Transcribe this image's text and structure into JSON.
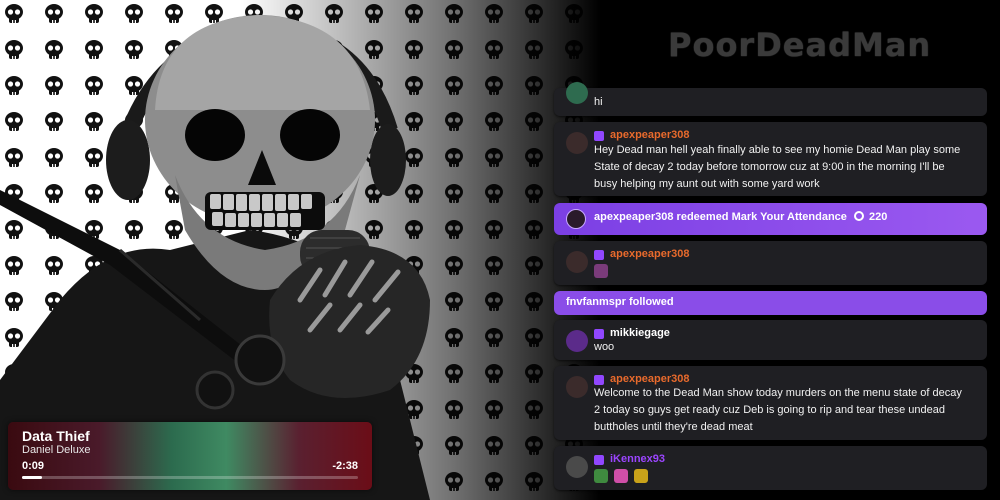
{
  "now_playing": {
    "title": "Data Thief",
    "artist": "Daniel Deluxe",
    "elapsed": "0:09",
    "remaining": "-2:38",
    "progress_fraction": 0.06
  },
  "logo": {
    "text": "PoorDeadMan"
  },
  "colors": {
    "accent_purple": "#9147ff",
    "chat_bg": "#1f1f23",
    "username_orange": "#e86a2c",
    "username_purple": "#9b45ff"
  },
  "chat": {
    "partial_message": {
      "text": "hi"
    },
    "messages": [
      {
        "username": "apexpeaper308",
        "text": "Hey Dead man hell yeah finally able to see my homie Dead Man play some State of decay 2 today before tomorrow cuz at 9:00 in the morning I'll be busy helping my aunt out with some yard work"
      },
      {
        "username": "apexpeaper308",
        "text": ""
      },
      {
        "username": "mikkiegage",
        "text": "woo"
      },
      {
        "username": "apexpeaper308",
        "text": "Welcome to the Dead Man show today murders on the menu state of decay 2 today so guys get ready cuz Deb is going to rip and tear these undead buttholes until they're dead meat"
      },
      {
        "username": "iKennex93",
        "text": ""
      }
    ],
    "redemption": {
      "text": "apexpeaper308 redeemed Mark Your Attendance",
      "points": "220"
    },
    "follow": {
      "text": "fnvfanmspr followed"
    }
  }
}
